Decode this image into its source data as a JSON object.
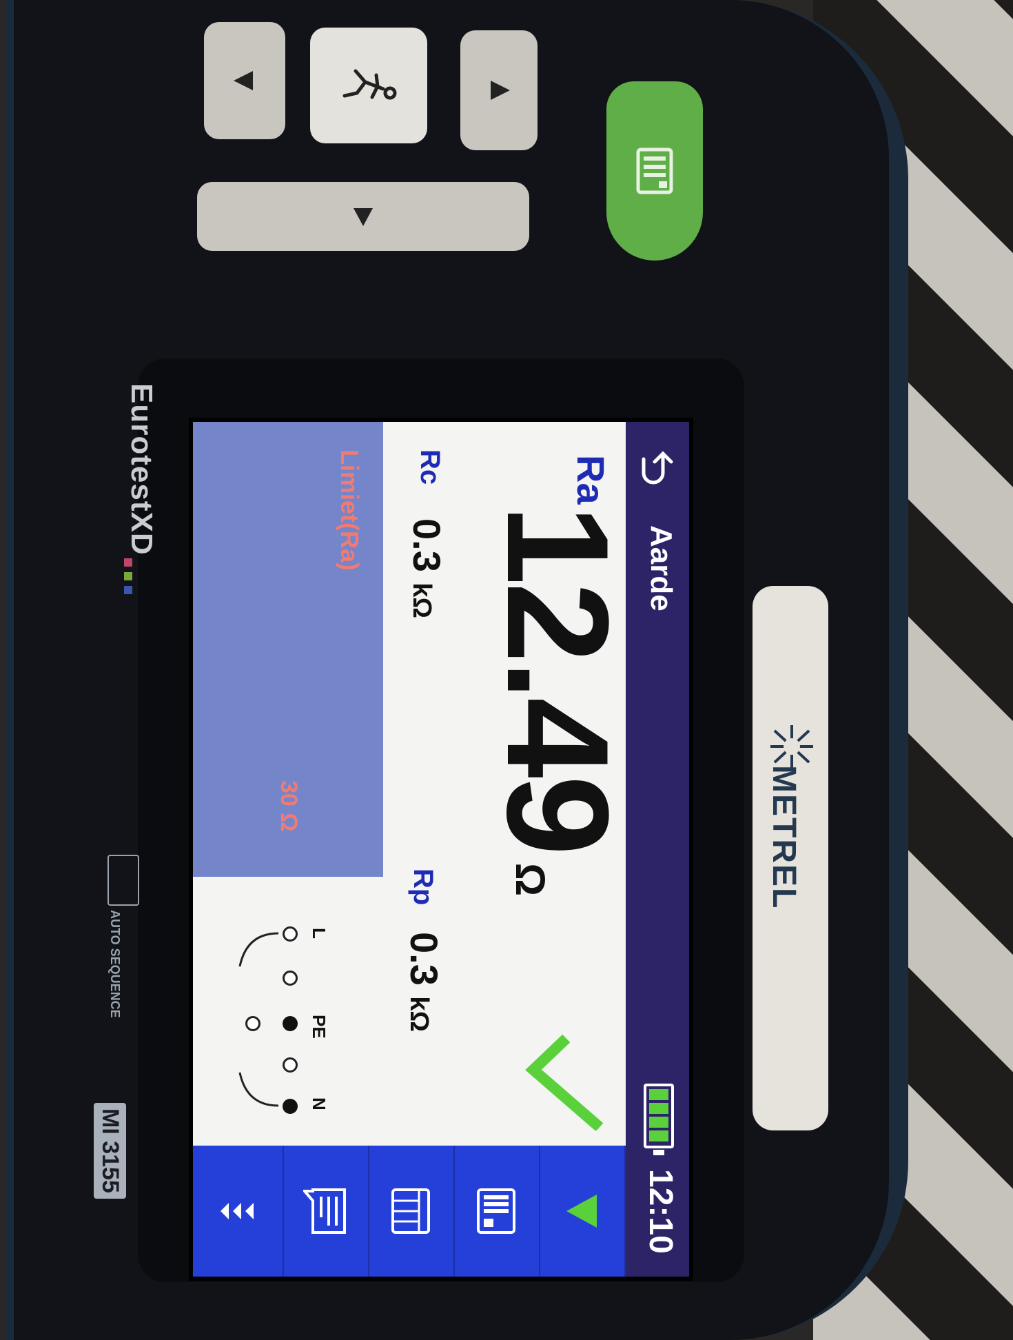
{
  "device": {
    "brand": "METREL",
    "product_line": "EurotestXD",
    "model": "MI 3155",
    "auto_sequence_label": "AUTO SEQUENCE"
  },
  "screen": {
    "title": "Aarde",
    "clock": "12:10",
    "battery_level_percent": 100,
    "status": "pass",
    "icons": {
      "back": "back-arrow-icon",
      "battery": "battery-icon",
      "result": "check-icon"
    }
  },
  "measurement": {
    "ra": {
      "label": "Ra",
      "value": "12.49",
      "unit": "Ω"
    },
    "rc": {
      "label": "Rc",
      "value": "0.3",
      "unit": "kΩ"
    },
    "rp": {
      "label": "Rp",
      "value": "0.3",
      "unit": "kΩ"
    }
  },
  "limit": {
    "label": "Limiet(Ra)",
    "value": "30 Ω"
  },
  "terminals": {
    "labels": [
      "L",
      "PE",
      "N"
    ]
  },
  "sidebar": {
    "buttons": [
      {
        "name": "start-test-button",
        "icon": "play-triangle-icon"
      },
      {
        "name": "save-button",
        "icon": "memory-card-icon"
      },
      {
        "name": "results-button",
        "icon": "results-grid-icon"
      },
      {
        "name": "comment-button",
        "icon": "comment-icon"
      },
      {
        "name": "more-button",
        "icon": "more-arrows-icon"
      }
    ]
  },
  "colors": {
    "topbar": "#2d2467",
    "sidebar": "#2540d8",
    "label_blue": "#1e2bb4",
    "limit_panel": "#7585c9",
    "limit_text": "#f07b73",
    "pass_green": "#5ad13b",
    "save_key": "#5fae47"
  }
}
